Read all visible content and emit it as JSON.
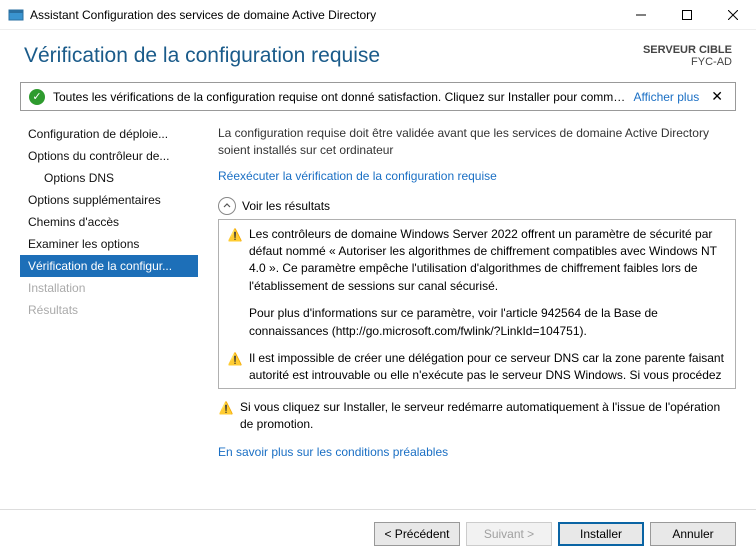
{
  "window": {
    "title": "Assistant Configuration des services de domaine Active Directory"
  },
  "header": {
    "heading": "Vérification de la configuration requise",
    "target_label": "SERVEUR CIBLE",
    "target_name": "FYC-AD"
  },
  "status": {
    "text": "Toutes les vérifications de la configuration requise ont donné satisfaction. Cliquez sur Installer pour comme...",
    "more": "Afficher plus",
    "close": "✕"
  },
  "sidebar": {
    "items": [
      {
        "label": "Configuration de déploie...",
        "active": false,
        "disabled": false,
        "sub": false
      },
      {
        "label": "Options du contrôleur de...",
        "active": false,
        "disabled": false,
        "sub": false
      },
      {
        "label": "Options DNS",
        "active": false,
        "disabled": false,
        "sub": true
      },
      {
        "label": "Options supplémentaires",
        "active": false,
        "disabled": false,
        "sub": false
      },
      {
        "label": "Chemins d'accès",
        "active": false,
        "disabled": false,
        "sub": false
      },
      {
        "label": "Examiner les options",
        "active": false,
        "disabled": false,
        "sub": false
      },
      {
        "label": "Vérification de la configur...",
        "active": true,
        "disabled": false,
        "sub": false
      },
      {
        "label": "Installation",
        "active": false,
        "disabled": true,
        "sub": false
      },
      {
        "label": "Résultats",
        "active": false,
        "disabled": true,
        "sub": false
      }
    ]
  },
  "main": {
    "intro": "La configuration requise doit être validée avant que les services de domaine Active Directory soient installés sur cet ordinateur",
    "rerun_link": "Réexécuter la vérification de la configuration requise",
    "results_header": "Voir les résultats",
    "warnings": [
      "Les contrôleurs de domaine Windows Server 2022 offrent un paramètre de sécurité par défaut nommé « Autoriser les algorithmes de chiffrement compatibles avec Windows NT 4.0 ». Ce paramètre empêche l'utilisation d'algorithmes de chiffrement faibles lors de l'établissement de sessions sur canal sécurisé.",
      "Il est impossible de créer une délégation pour ce serveur DNS car la zone parente faisant autorité est introuvable ou elle n'exécute pas le serveur DNS Windows. Si vous procédez à l'intégration avec une infrastructure DNS existante, vous devez"
    ],
    "warning1_extra": "Pour plus d'informations sur ce paramètre, voir l'article 942564 de la Base de connaissances (http://go.microsoft.com/fwlink/?LinkId=104751).",
    "install_warning": "Si vous cliquez sur Installer, le serveur redémarre automatiquement à l'issue de l'opération de promotion.",
    "learn_more": "En savoir plus sur les conditions préalables"
  },
  "footer": {
    "prev": "< Précédent",
    "next": "Suivant >",
    "install": "Installer",
    "cancel": "Annuler"
  }
}
